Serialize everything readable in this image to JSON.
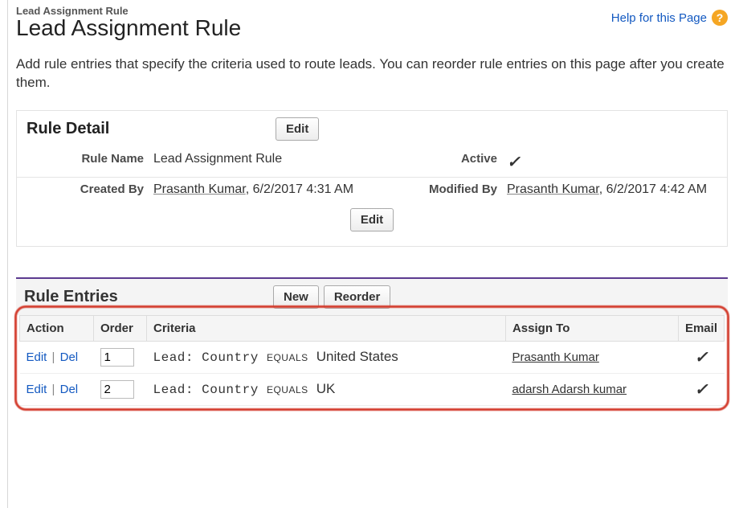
{
  "header": {
    "breadcrumb": "Lead Assignment Rule",
    "title": "Lead Assignment Rule",
    "help_text": "Help for this Page",
    "help_icon_glyph": "?"
  },
  "intro": "Add rule entries that specify the criteria used to route leads. You can reorder rule entries on this page after you create them.",
  "rule_detail": {
    "section_label": "Rule Detail",
    "edit_label": "Edit",
    "labels": {
      "rule_name": "Rule Name",
      "active": "Active",
      "created_by": "Created By",
      "modified_by": "Modified By"
    },
    "rule_name": "Lead Assignment Rule",
    "active_checked": "✓",
    "created_by_user": "Prasanth Kumar",
    "created_by_meta": ", 6/2/2017 4:31 AM",
    "modified_by_user": "Prasanth Kumar",
    "modified_by_meta": ", 6/2/2017 4:42 AM"
  },
  "rule_entries": {
    "section_label": "Rule Entries",
    "new_label": "New",
    "reorder_label": "Reorder",
    "columns": {
      "action": "Action",
      "order": "Order",
      "criteria": "Criteria",
      "assign_to": "Assign To",
      "email": "Email"
    },
    "action_edit": "Edit",
    "action_del": "Del",
    "equals_word": "EQUALS",
    "lead_country_label": "Lead: Country",
    "rows": [
      {
        "order": "1",
        "criteria_value": "United States",
        "assign_to": "Prasanth Kumar",
        "email_checked": "✓"
      },
      {
        "order": "2",
        "criteria_value": "UK",
        "assign_to": "adarsh Adarsh kumar",
        "email_checked": "✓"
      }
    ]
  }
}
